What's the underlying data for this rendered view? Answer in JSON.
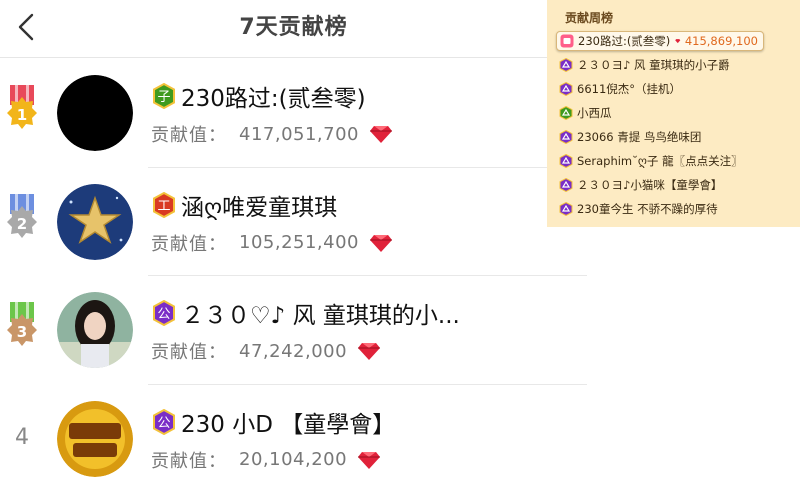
{
  "header": {
    "title": "7天贡献榜",
    "back_icon": "back-chevron-icon"
  },
  "colors": {
    "gem_red": "#e0223a",
    "weekly_panel_bg": "#fdebc3",
    "badge_green": "#3f9a1e",
    "badge_red": "#d93a22",
    "badge_purple": "#7a2dc7",
    "medal_gold": "#f2b51a",
    "medal_silver": "#a9a9a9",
    "medal_bronze": "#c99668"
  },
  "ranking": [
    {
      "rank": "1",
      "badge_text": "子",
      "badge_color": "#3f9a1e",
      "name": "230路过:(贰叁零)",
      "value_label": "贡献值：",
      "value": "417,051,700"
    },
    {
      "rank": "2",
      "badge_text": "工",
      "badge_color": "#d93a22",
      "name": "涵ღ唯爱童琪琪",
      "value_label": "贡献值：",
      "value": "105,251,400"
    },
    {
      "rank": "3",
      "badge_text": "公",
      "badge_color": "#7a2dc7",
      "name": "２３０♡♪ 风  童琪琪的小...",
      "value_label": "贡献值：",
      "value": "47,242,000"
    },
    {
      "rank": "4",
      "badge_text": "公",
      "badge_color": "#7a2dc7",
      "name": "230 小D 【童學會】",
      "value_label": "贡献值：",
      "value": "20,104,200"
    }
  ],
  "weekly": {
    "title": "贡献周榜",
    "items": [
      {
        "name": "230路过:(贰叁零)",
        "score": "415,869,100"
      },
      {
        "name": "２３０ヨ♪ 风  童琪琪的小子爵"
      },
      {
        "name": "6611倪杰°（挂机）"
      },
      {
        "name": "小西瓜"
      },
      {
        "name": "23066 青提 鸟鸟绝味团"
      },
      {
        "name": "Seraphim˘ღ子   龍〖点点关注〗"
      },
      {
        "name": "２３０ヨ♪小猫咪【童學會】"
      },
      {
        "name": "230童今生 不骄不躁的厚待"
      }
    ]
  }
}
